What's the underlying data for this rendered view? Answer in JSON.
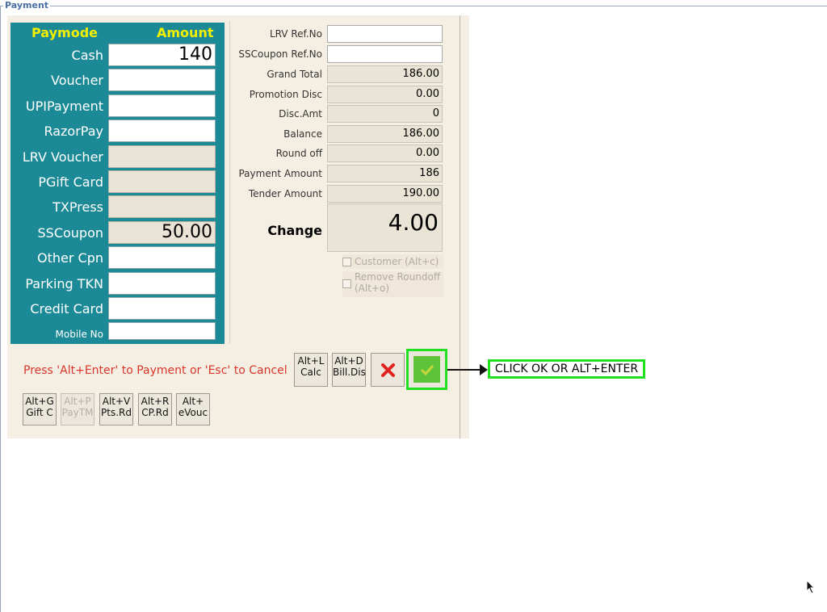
{
  "window": {
    "title": "Payment"
  },
  "paymode": {
    "header_mode": "Paymode",
    "header_amount": "Amount",
    "rows": [
      {
        "label": "Cash",
        "value": "140",
        "enabled": true
      },
      {
        "label": "Voucher",
        "value": "",
        "enabled": true
      },
      {
        "label": "UPIPayment",
        "value": "",
        "enabled": true
      },
      {
        "label": "RazorPay",
        "value": "",
        "enabled": true
      },
      {
        "label": "LRV Voucher",
        "value": "",
        "enabled": false
      },
      {
        "label": "PGift Card",
        "value": "",
        "enabled": false
      },
      {
        "label": "TXPress",
        "value": "",
        "enabled": false
      },
      {
        "label": "SSCoupon",
        "value": "50.00",
        "enabled": false
      },
      {
        "label": "Other Cpn",
        "value": "",
        "enabled": true
      },
      {
        "label": "Parking TKN",
        "value": "",
        "enabled": true
      },
      {
        "label": "Credit Card",
        "value": "",
        "enabled": true
      },
      {
        "label": "Mobile No",
        "value": "",
        "enabled": true
      }
    ]
  },
  "summary": {
    "lrv_ref_label": "LRV Ref.No",
    "lrv_ref_value": "",
    "sscoupon_ref_label": "SSCoupon Ref.No",
    "sscoupon_ref_value": "",
    "grand_total_label": "Grand Total",
    "grand_total_value": "186.00",
    "promotion_disc_label": "Promotion Disc",
    "promotion_disc_value": "0.00",
    "disc_amt_label": "Disc.Amt",
    "disc_amt_value": "0",
    "balance_label": "Balance",
    "balance_value": "186.00",
    "round_off_label": "Round off",
    "round_off_value": "0.00",
    "payment_amount_label": "Payment Amount",
    "payment_amount_value": "186",
    "tender_amount_label": "Tender Amount",
    "tender_amount_value": "190.00",
    "change_label": "Change",
    "change_value": "4.00",
    "customer_check_label": "Customer (Alt+c)",
    "remove_roundoff_label": "Remove Roundoff (Alt+o)"
  },
  "footer": {
    "hint": "Press 'Alt+Enter' to Payment or 'Esc' to Cancel",
    "calc_btn": [
      "Alt+L",
      "Calc"
    ],
    "billdis_btn": [
      "Alt+D",
      "Bill.Dis"
    ],
    "gift_btn": [
      "Alt+G",
      "Gift C"
    ],
    "paytm_btn": [
      "Alt+P",
      "PayTM"
    ],
    "pts_btn": [
      "Alt+V",
      "Pts.Rd"
    ],
    "cprd_btn": [
      "Alt+R",
      "CP.Rd"
    ],
    "evouc_btn": [
      "Alt+",
      "eVouc"
    ]
  },
  "callout": {
    "text": "CLICK OK OR ALT+ENTER"
  },
  "colors": {
    "teal": "#1c8a96",
    "header_yellow": "#f3f000",
    "highlight_green": "#21e021",
    "hint_red": "#d9362a"
  }
}
